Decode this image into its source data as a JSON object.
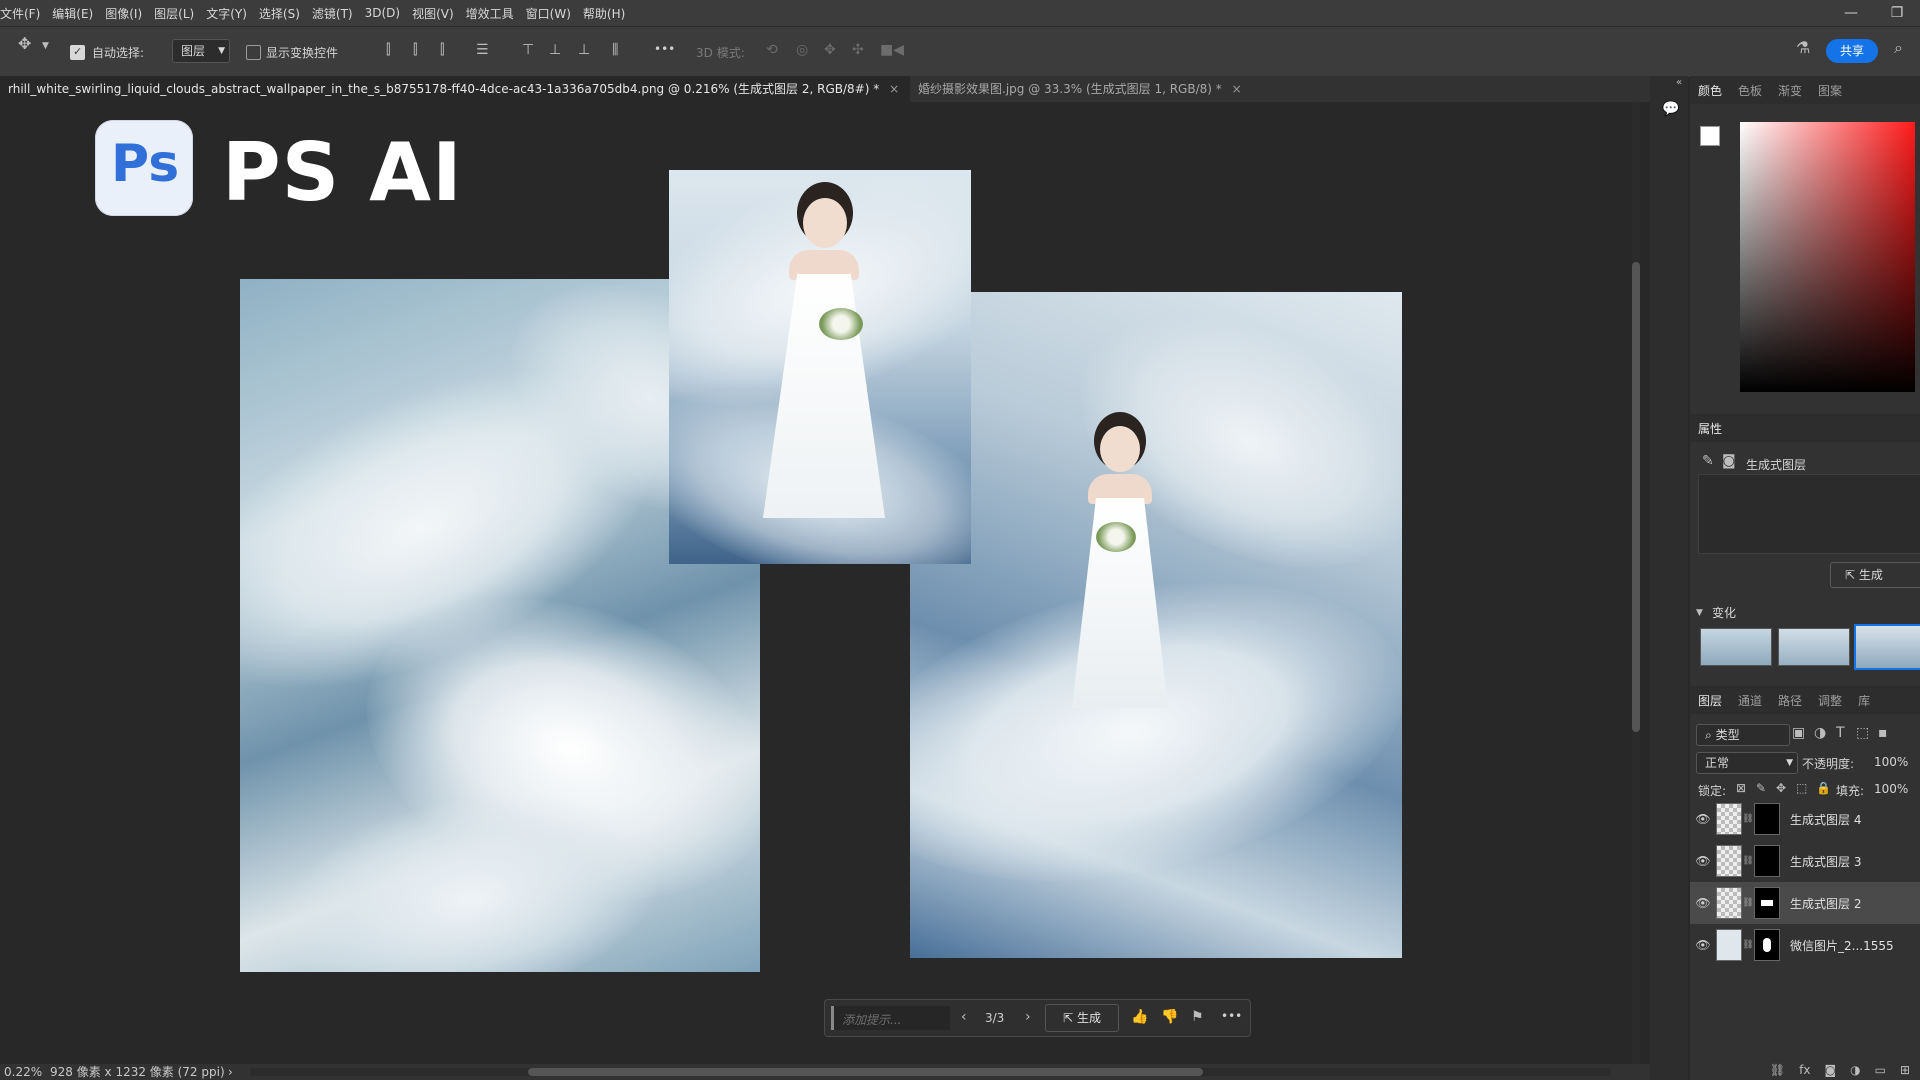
{
  "menu": {
    "items": [
      "文件(F)",
      "编辑(E)",
      "图像(I)",
      "图层(L)",
      "文字(Y)",
      "选择(S)",
      "滤镜(T)",
      "3D(D)",
      "视图(V)",
      "增效工具",
      "窗口(W)",
      "帮助(H)"
    ]
  },
  "options": {
    "auto_select_label": "自动选择:",
    "auto_select_checked": true,
    "layer_dropdown": "图层",
    "show_transform_label": "显示变换控件",
    "mode_3d_label": "3D 模式:",
    "share_label": "共享",
    "more_label": "•••"
  },
  "tabs": [
    {
      "label": "rhill_white_swirling_liquid_clouds_abstract_wallpaper_in_the_s_b8755178-ff40-4dce-ac43-1a336a705db4.png @ 0.216% (生成式图层 2, RGB/8#) *",
      "active": true
    },
    {
      "label": "婚纱摄影效果图.jpg @ 33.3% (生成式图层 1, RGB/8) *",
      "active": false
    }
  ],
  "canvas": {
    "logo_text": "Ps",
    "headline": "PS AI"
  },
  "taskbar": {
    "prompt_placeholder": "添加提示...",
    "counter": "3/3",
    "generate_label": "生成"
  },
  "status": {
    "zoom": "0.22%",
    "dimensions": "928 像素 x 1232 像素 (72 ppi)"
  },
  "color_panel": {
    "tabs": [
      "颜色",
      "色板",
      "渐变",
      "图案"
    ],
    "active": 0
  },
  "properties_panel": {
    "title": "属性",
    "layer_type": "生成式图层",
    "generate_label": "生成",
    "variations_label": "变化"
  },
  "layers_panel": {
    "tabs": [
      "图层",
      "通道",
      "路径",
      "调整",
      "库"
    ],
    "active": 0,
    "filter_label": "类型",
    "blend_mode": "正常",
    "opacity_label": "不透明度:",
    "opacity_value": "100%",
    "lock_label": "锁定:",
    "fill_label": "填充:",
    "fill_value": "100%",
    "layers": [
      {
        "name": "生成式图层 4",
        "selected": false
      },
      {
        "name": "生成式图层 3",
        "selected": false
      },
      {
        "name": "生成式图层 2",
        "selected": true
      },
      {
        "name": "微信图片_2...1555",
        "selected": false
      }
    ]
  },
  "colors": {
    "accent": "#1473e6",
    "panel_bg": "#323232",
    "canvas_bg": "#282828",
    "ps_logo_bg": "#eaf0fa",
    "ps_logo_text": "#3170d9"
  }
}
